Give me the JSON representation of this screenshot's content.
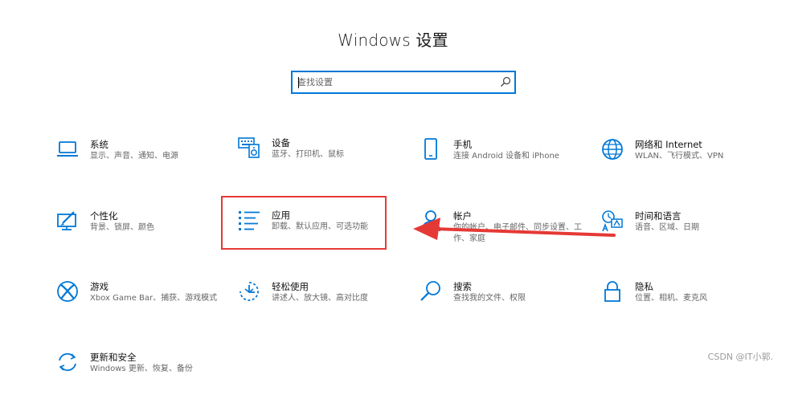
{
  "window": {
    "title": "Windows 设置"
  },
  "search": {
    "placeholder": "查找设置"
  },
  "tiles": [
    {
      "title": "系统",
      "desc": "显示、声音、通知、电源",
      "icon": "laptop-icon"
    },
    {
      "title": "设备",
      "desc": "蓝牙、打印机、鼠标",
      "icon": "keyboard-speaker-icon"
    },
    {
      "title": "手机",
      "desc": "连接 Android 设备和 iPhone",
      "icon": "phone-icon"
    },
    {
      "title": "网络和 Internet",
      "desc": "WLAN、飞行模式、VPN",
      "icon": "globe-icon"
    },
    {
      "title": "个性化",
      "desc": "背景、锁屏、颜色",
      "icon": "paint-screen-icon"
    },
    {
      "title": "应用",
      "desc": "卸载、默认应用、可选功能",
      "icon": "apps-list-icon"
    },
    {
      "title": "帐户",
      "desc": "你的帐户、电子邮件、同步设置、工作、家庭",
      "icon": "person-icon"
    },
    {
      "title": "时间和语言",
      "desc": "语音、区域、日期",
      "icon": "time-language-icon"
    },
    {
      "title": "游戏",
      "desc": "Xbox Game Bar、捕获、游戏模式",
      "icon": "xbox-icon"
    },
    {
      "title": "轻松使用",
      "desc": "讲述人、放大镜、高对比度",
      "icon": "ease-of-access-icon"
    },
    {
      "title": "搜索",
      "desc": "查找我的文件、权限",
      "icon": "magnifier-icon"
    },
    {
      "title": "隐私",
      "desc": "位置、相机、麦克风",
      "icon": "lock-icon"
    },
    {
      "title": "更新和安全",
      "desc": "Windows 更新、恢复、备份",
      "icon": "sync-icon"
    }
  ],
  "colors": {
    "accent": "#0078d7",
    "highlight": "#e53935"
  },
  "watermark": "CSDN @IT小郭."
}
